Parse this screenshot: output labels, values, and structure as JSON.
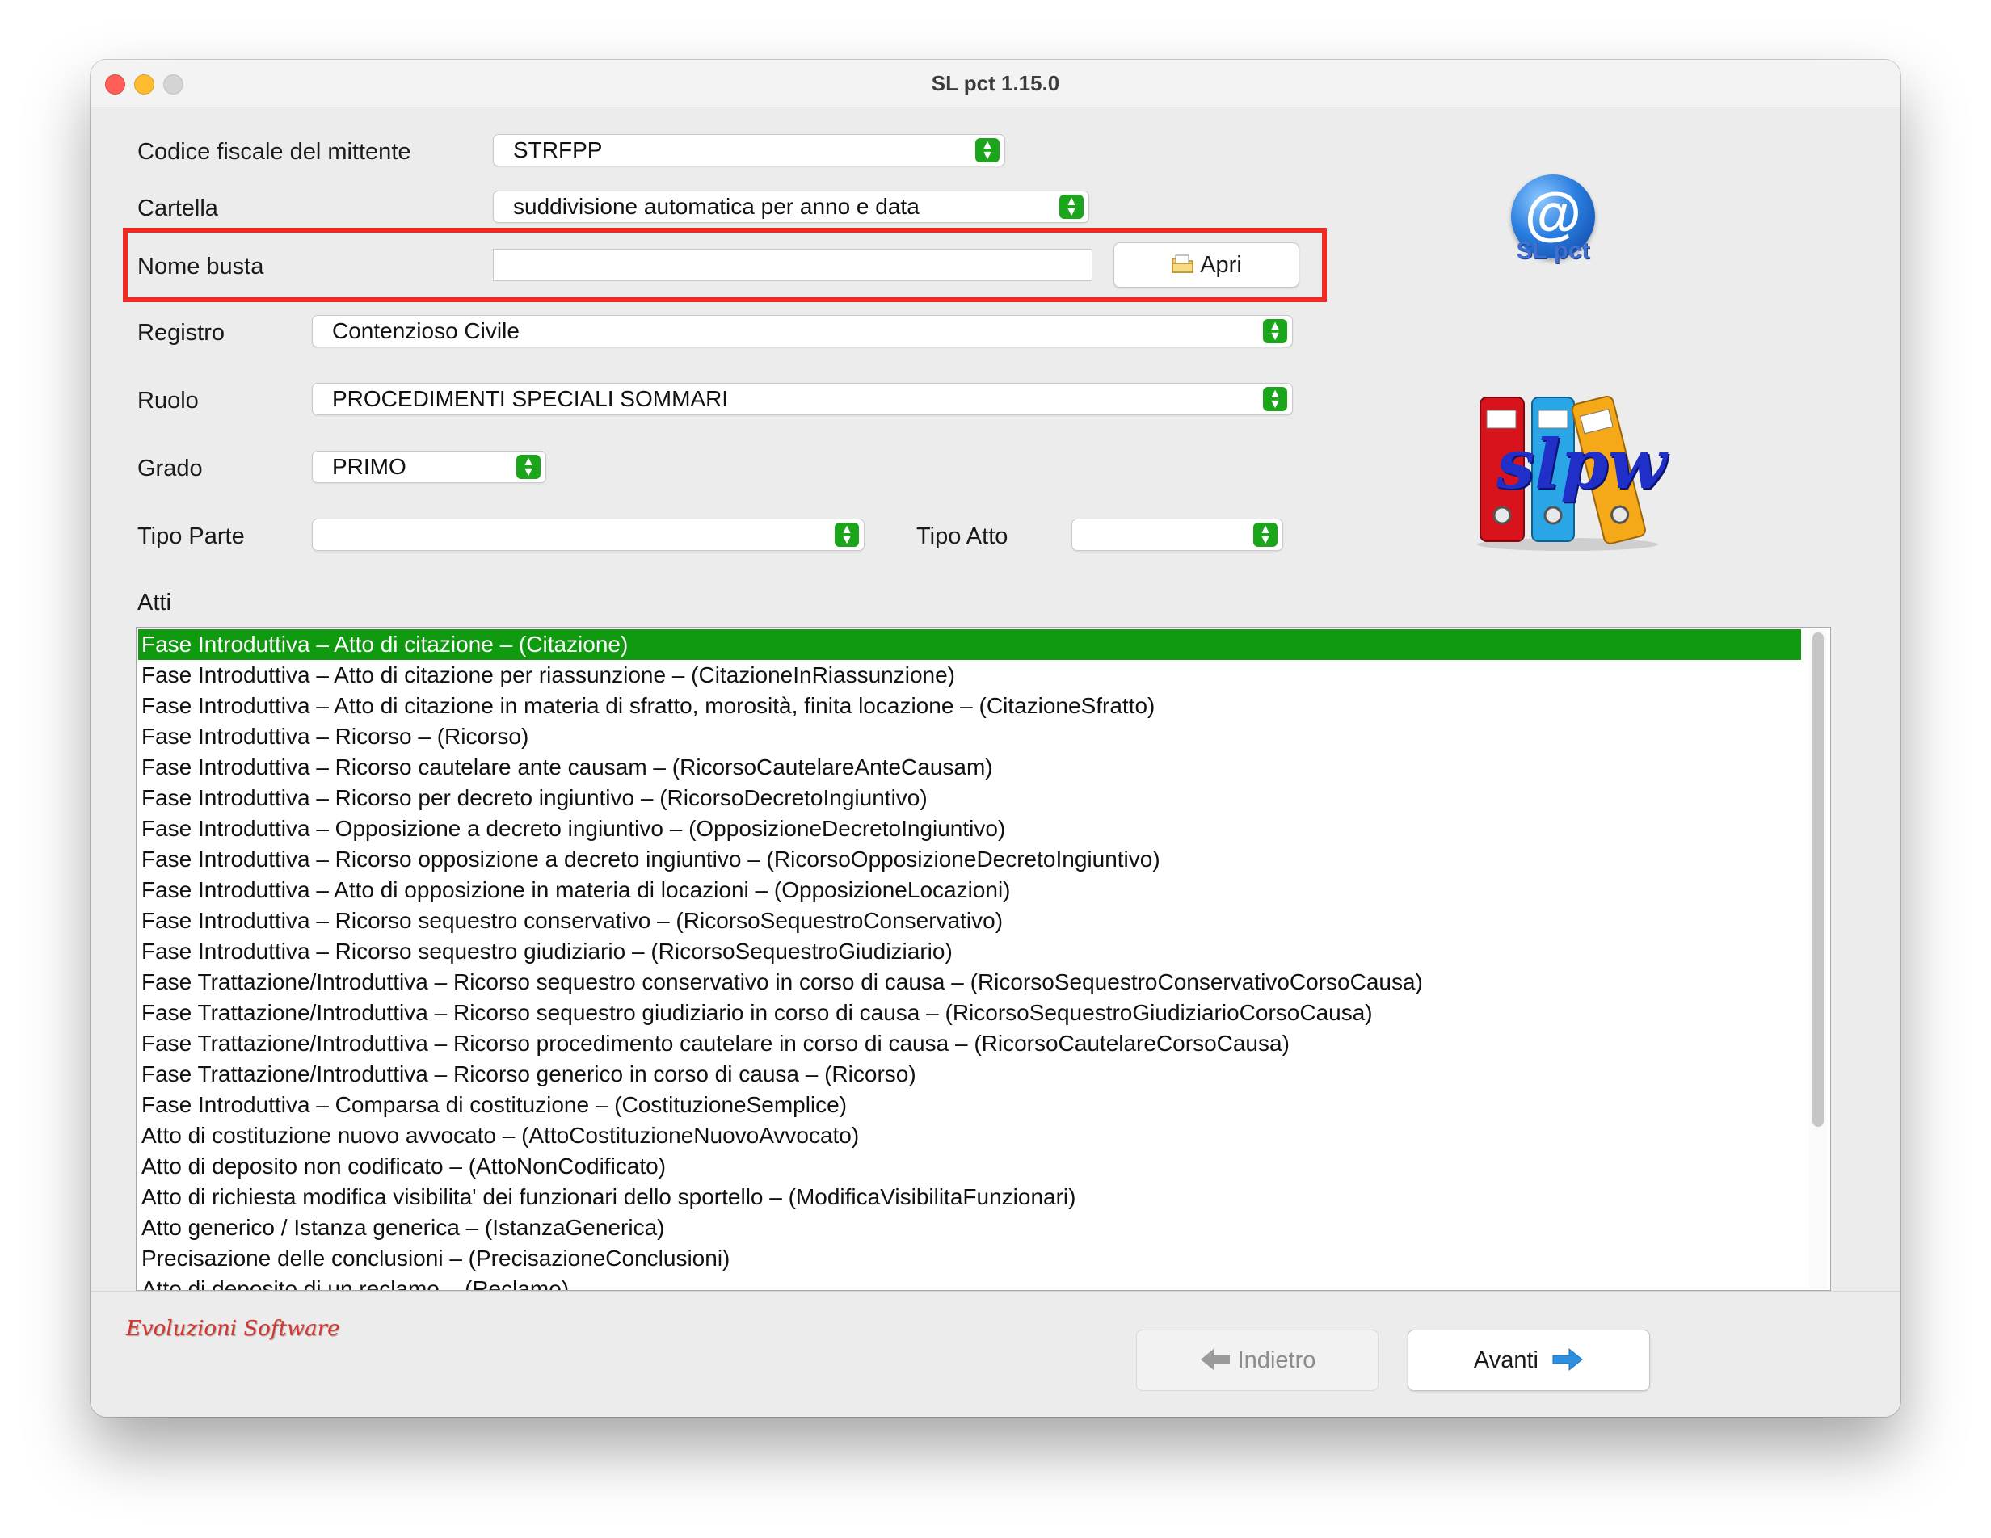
{
  "window": {
    "title": "SL pct 1.15.0"
  },
  "form": {
    "codice_fiscale": {
      "label": "Codice fiscale del mittente",
      "value": "STRFPP"
    },
    "cartella": {
      "label": "Cartella",
      "value": "suddivisione automatica per anno e data"
    },
    "nome_busta": {
      "label": "Nome busta",
      "value": "",
      "button_label": "Apri"
    },
    "registro": {
      "label": "Registro",
      "value": "Contenzioso Civile"
    },
    "ruolo": {
      "label": "Ruolo",
      "value": "PROCEDIMENTI SPECIALI SOMMARI"
    },
    "grado": {
      "label": "Grado",
      "value": "PRIMO"
    },
    "tipo_parte": {
      "label": "Tipo Parte",
      "value": ""
    },
    "tipo_atto": {
      "label": "Tipo Atto",
      "value": ""
    }
  },
  "atti": {
    "label": "Atti",
    "selected_index": 0,
    "items": [
      "Fase Introduttiva – Atto di citazione – (Citazione)",
      "Fase Introduttiva – Atto di citazione per riassunzione – (CitazioneInRiassunzione)",
      "Fase Introduttiva – Atto di citazione in materia di sfratto, morosità, finita locazione – (CitazioneSfratto)",
      "Fase Introduttiva – Ricorso – (Ricorso)",
      "Fase Introduttiva – Ricorso cautelare ante causam – (RicorsoCautelareAnteCausam)",
      "Fase Introduttiva – Ricorso per decreto ingiuntivo – (RicorsoDecretoIngiuntivo)",
      "Fase Introduttiva – Opposizione a decreto ingiuntivo – (OpposizioneDecretoIngiuntivo)",
      "Fase Introduttiva – Ricorso opposizione a decreto ingiuntivo – (RicorsoOpposizioneDecretoIngiuntivo)",
      "Fase Introduttiva – Atto di opposizione in materia di locazioni – (OpposizioneLocazioni)",
      "Fase Introduttiva – Ricorso sequestro conservativo – (RicorsoSequestroConservativo)",
      "Fase Introduttiva – Ricorso sequestro giudiziario – (RicorsoSequestroGiudiziario)",
      "Fase Trattazione/Introduttiva – Ricorso sequestro conservativo in corso di causa – (RicorsoSequestroConservativoCorsoCausa)",
      "Fase Trattazione/Introduttiva – Ricorso sequestro giudiziario in corso di causa – (RicorsoSequestroGiudiziarioCorsoCausa)",
      "Fase Trattazione/Introduttiva – Ricorso procedimento cautelare in corso di causa – (RicorsoCautelareCorsoCausa)",
      "Fase Trattazione/Introduttiva – Ricorso generico in corso di causa – (Ricorso)",
      "Fase Introduttiva – Comparsa di costituzione – (CostituzioneSemplice)",
      "Atto di costituzione nuovo avvocato – (AttoCostituzioneNuovoAvvocato)",
      "Atto di deposito non codificato – (AttoNonCodificato)",
      "Atto di richiesta modifica visibilita' dei funzionari dello sportello – (ModificaVisibilitaFunzionari)",
      "Atto generico / Istanza generica – (IstanzaGenerica)",
      "Precisazione delle conclusioni – (PrecisazioneConclusioni)",
      "Atto di deposito di un reclamo – (Reclamo)"
    ]
  },
  "logos": {
    "slpct_top": "@",
    "slpct_bottom": "SL pct",
    "slpw": "slpw",
    "brand": "Evoluzioni Software"
  },
  "nav": {
    "back_label": "Indietro",
    "next_label": "Avanti"
  },
  "colors": {
    "accent_green": "#109a10",
    "highlight_red": "#ee2a22",
    "arrow_blue": "#2c8fe0"
  }
}
